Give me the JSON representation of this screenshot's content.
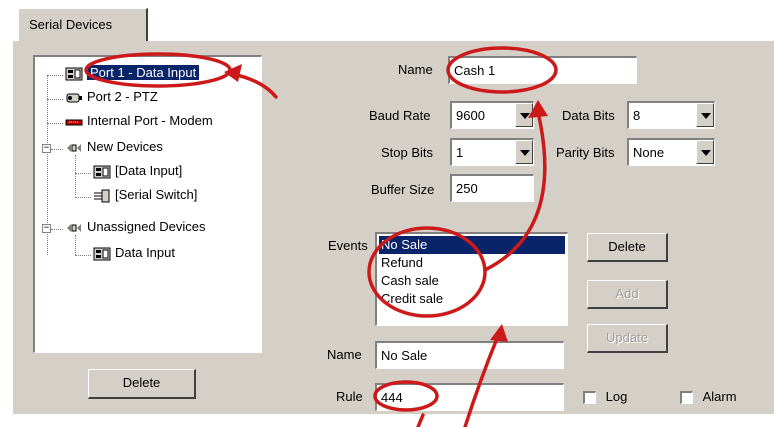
{
  "tab": {
    "label": "Serial Devices"
  },
  "tree": {
    "items": [
      {
        "label": "Port 1 - Data Input",
        "icon": "data-input-icon",
        "selected": true
      },
      {
        "label": "Port 2 - PTZ",
        "icon": "ptz-camera-icon"
      },
      {
        "label": "Internal Port - Modem",
        "icon": "modem-icon"
      },
      {
        "label": "New Devices",
        "icon": "device-group-icon"
      },
      {
        "label": "[Data Input]",
        "icon": "data-input-icon"
      },
      {
        "label": "[Serial Switch]",
        "icon": "serial-switch-icon"
      },
      {
        "label": "Unassigned Devices",
        "icon": "device-group-icon"
      },
      {
        "label": "Data Input",
        "icon": "data-input-icon"
      }
    ],
    "delete_label": "Delete"
  },
  "form": {
    "name_label": "Name",
    "name_value": "Cash 1",
    "baud_label": "Baud Rate",
    "baud_value": "9600",
    "databits_label": "Data Bits",
    "databits_value": "8",
    "stopbits_label": "Stop Bits",
    "stopbits_value": "1",
    "parity_label": "Parity Bits",
    "parity_value": "None",
    "buffer_label": "Buffer Size",
    "buffer_value": "250"
  },
  "events": {
    "label": "Events",
    "items": [
      "No Sale",
      "Refund",
      "Cash sale",
      "Credit sale"
    ],
    "selected_index": 0,
    "delete_label": "Delete",
    "add_label": "Add",
    "update_label": "Update"
  },
  "event_detail": {
    "name_label": "Name",
    "name_value": "No Sale",
    "rule_label": "Rule",
    "rule_value": "444",
    "log_label": "Log",
    "alarm_label": "Alarm"
  },
  "colors": {
    "panel": "#d4d0c8",
    "selection": "#0a246a",
    "annotation": "#cc1a1a"
  }
}
